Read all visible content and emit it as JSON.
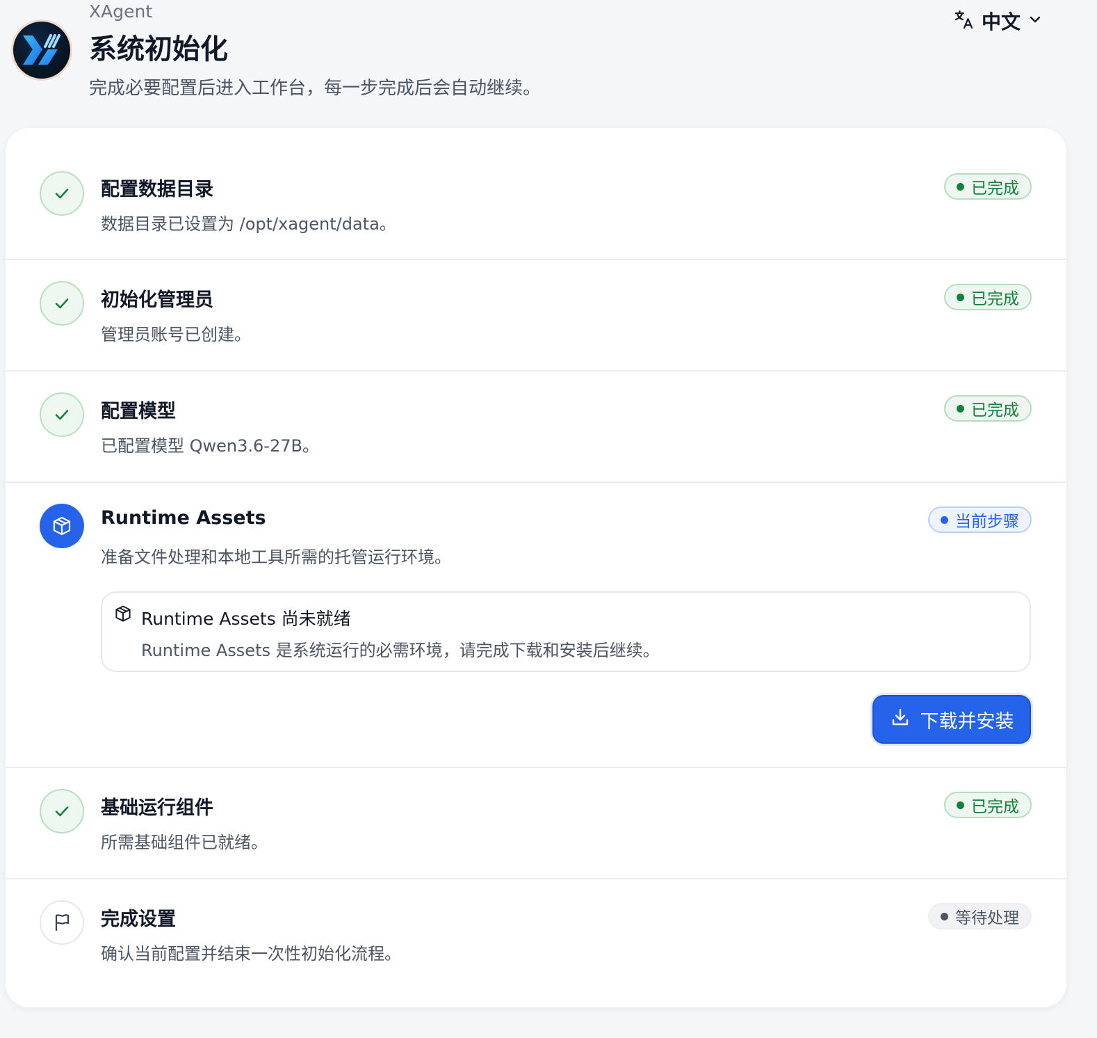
{
  "header": {
    "app_name": "XAgent",
    "title": "系统初始化",
    "subtitle": "完成必要配置后进入工作台，每一步完成后会自动继续。",
    "language_label": "中文",
    "logo_icon": "xagent-logo-icon"
  },
  "colors": {
    "primary": "#2563eb",
    "success": "#15803d",
    "muted": "#4b5563"
  },
  "steps": [
    {
      "title": "配置数据目录",
      "description": "数据目录已设置为 /opt/xagent/data。",
      "status": "已完成",
      "icon": "check-icon"
    },
    {
      "title": "初始化管理员",
      "description": "管理员账号已创建。",
      "status": "已完成",
      "icon": "check-icon"
    },
    {
      "title": "配置模型",
      "description": "已配置模型 Qwen3.6-27B。",
      "status": "已完成",
      "icon": "check-icon"
    },
    {
      "title": "Runtime Assets",
      "description": "准备文件处理和本地工具所需的托管运行环境。",
      "status": "当前步骤",
      "icon": "package-icon",
      "notice": {
        "title": "Runtime Assets 尚未就绪",
        "description": "Runtime Assets 是系统运行的必需环境，请完成下载和安装后继续。",
        "icon": "package-icon"
      },
      "action": {
        "label": "下载并安装",
        "icon": "download-icon"
      }
    },
    {
      "title": "基础运行组件",
      "description": "所需基础组件已就绪。",
      "status": "已完成",
      "icon": "check-icon"
    },
    {
      "title": "完成设置",
      "description": "确认当前配置并结束一次性初始化流程。",
      "status": "等待处理",
      "icon": "flag-icon"
    }
  ]
}
